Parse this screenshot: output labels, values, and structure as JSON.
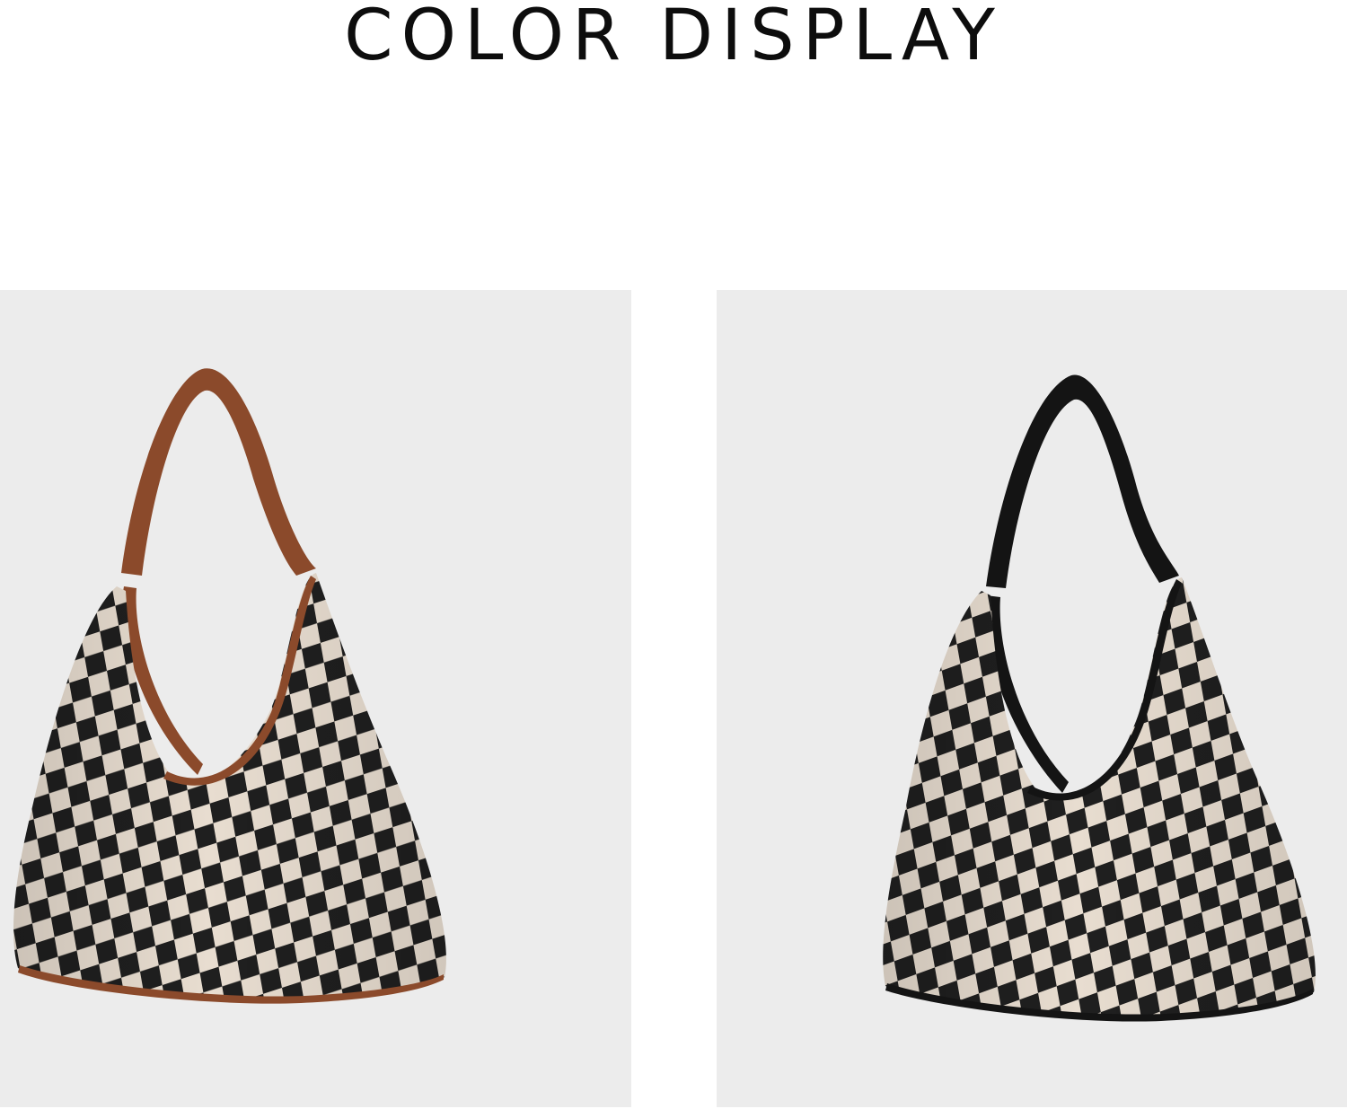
{
  "header": {
    "title": "COLOR DISPLAY"
  },
  "products": [
    {
      "variant": "brown-strap",
      "strap_color": "#8b4a2b",
      "check_dark": "#1f1f1f",
      "check_light": "#e8ddd0"
    },
    {
      "variant": "black-strap",
      "strap_color": "#141414",
      "check_dark": "#1f1f1f",
      "check_light": "#e8ddd0"
    }
  ],
  "colors": {
    "background": "#ffffff",
    "panel": "#ececec",
    "title": "#0d0d0d"
  }
}
